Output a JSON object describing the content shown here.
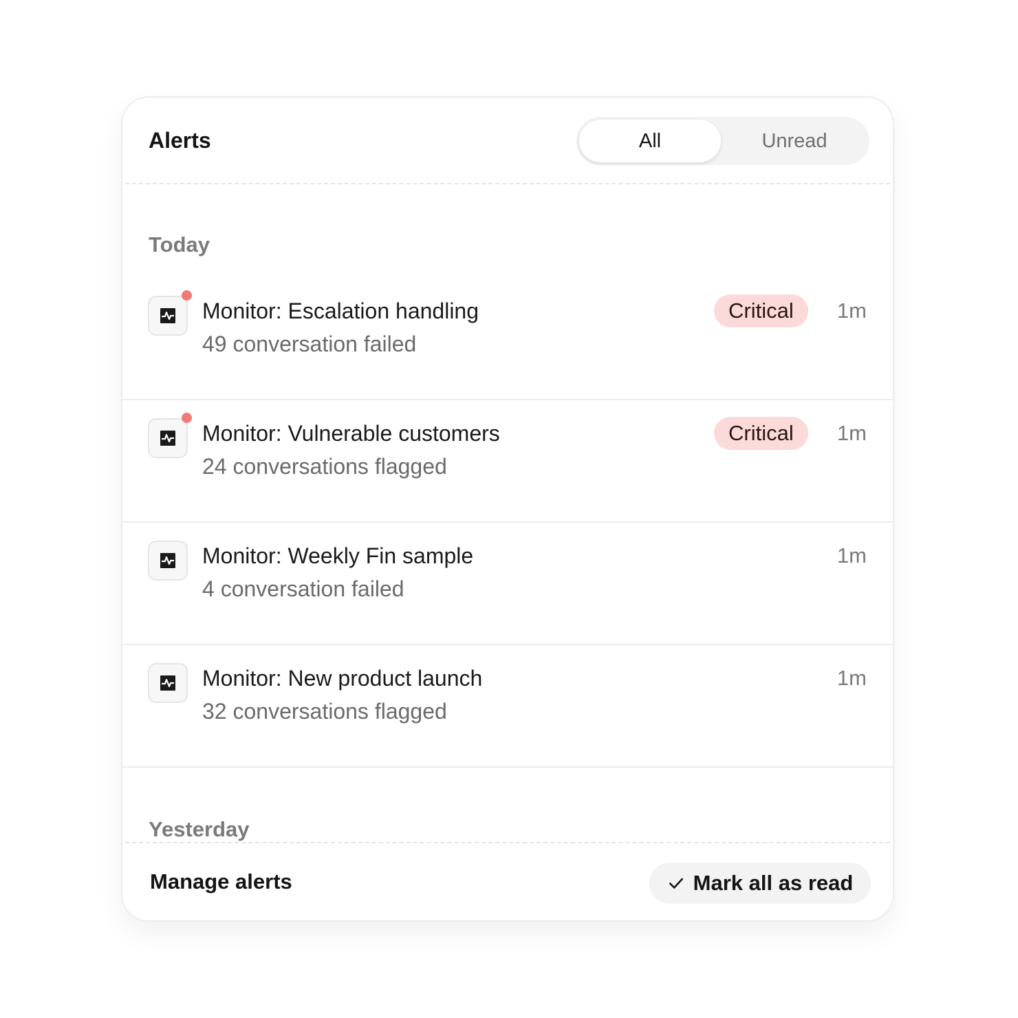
{
  "header": {
    "title": "Alerts",
    "tabs": [
      {
        "label": "All",
        "selected": true
      },
      {
        "label": "Unread",
        "selected": false
      }
    ]
  },
  "sections": {
    "today": "Today",
    "yesterday": "Yesterday"
  },
  "alerts": [
    {
      "title": "Monitor: Escalation handling",
      "subtitle": "49 conversation failed",
      "badge": "Critical",
      "time": "1m",
      "unread": true,
      "icon": "activity-icon"
    },
    {
      "title": "Monitor: Vulnerable customers",
      "subtitle": "24 conversations flagged",
      "badge": "Critical",
      "time": "1m",
      "unread": true,
      "icon": "activity-icon"
    },
    {
      "title": "Monitor: Weekly Fin sample",
      "subtitle": "4 conversation failed",
      "badge": "",
      "time": "1m",
      "unread": false,
      "icon": "activity-icon"
    },
    {
      "title": "Monitor: New product launch",
      "subtitle": "32 conversations flagged",
      "badge": "",
      "time": "1m",
      "unread": false,
      "icon": "activity-icon"
    }
  ],
  "footer": {
    "manage_label": "Manage alerts",
    "mark_all_label": "Mark all as read",
    "mark_all_icon": "check-icon"
  },
  "colors": {
    "critical_badge_bg": "#fddada",
    "unread_dot": "#f07a78",
    "segment_bg": "#f3f3f3"
  }
}
